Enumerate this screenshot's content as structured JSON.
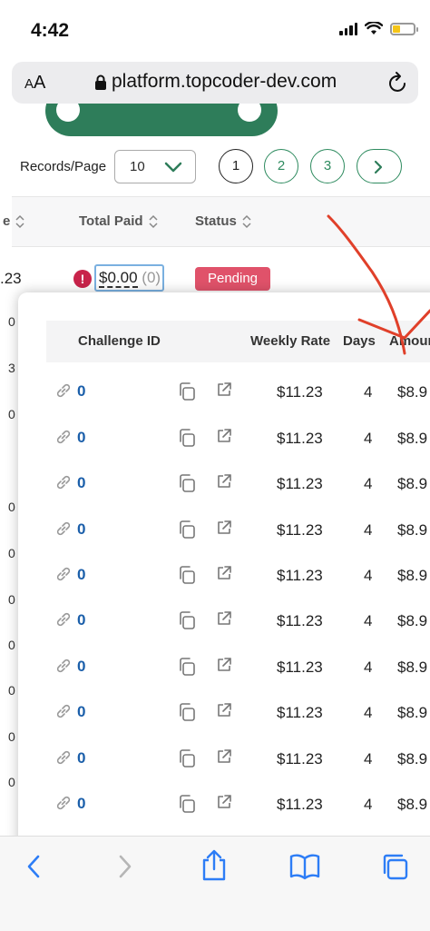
{
  "status_bar": {
    "time": "4:42"
  },
  "browser": {
    "aa_label": "A",
    "aa_label_big": "A",
    "url": "platform.topcoder-dev.com"
  },
  "pagination": {
    "records_label": "Records/Page",
    "records_value": "10",
    "pages": [
      "1",
      "2",
      "3"
    ],
    "active_page": "1"
  },
  "table": {
    "columns": [
      "e",
      "Total Paid",
      "Status"
    ],
    "row": {
      "amount": ".23",
      "paid_value": "$0.00",
      "paid_count": "(0)",
      "status": "Pending"
    }
  },
  "popup": {
    "columns": [
      "Challenge ID",
      "Weekly Rate",
      "Days",
      "Amour"
    ],
    "rows": [
      {
        "challenge_id": "0",
        "weekly_rate": "$11.23",
        "days": "4",
        "amount": "$8.9"
      },
      {
        "challenge_id": "0",
        "weekly_rate": "$11.23",
        "days": "4",
        "amount": "$8.9"
      },
      {
        "challenge_id": "0",
        "weekly_rate": "$11.23",
        "days": "4",
        "amount": "$8.9"
      },
      {
        "challenge_id": "0",
        "weekly_rate": "$11.23",
        "days": "4",
        "amount": "$8.9"
      },
      {
        "challenge_id": "0",
        "weekly_rate": "$11.23",
        "days": "4",
        "amount": "$8.9"
      },
      {
        "challenge_id": "0",
        "weekly_rate": "$11.23",
        "days": "4",
        "amount": "$8.9"
      },
      {
        "challenge_id": "0",
        "weekly_rate": "$11.23",
        "days": "4",
        "amount": "$8.9"
      },
      {
        "challenge_id": "0",
        "weekly_rate": "$11.23",
        "days": "4",
        "amount": "$8.9"
      },
      {
        "challenge_id": "0",
        "weekly_rate": "$11.23",
        "days": "4",
        "amount": "$8.9"
      },
      {
        "challenge_id": "0",
        "weekly_rate": "$11.23",
        "days": "4",
        "amount": "$8.9"
      }
    ]
  },
  "background_side_digits": [
    "0",
    "3",
    "0",
    "0",
    "0",
    "0",
    "0",
    "0",
    "0",
    "0"
  ],
  "colors": {
    "brand_green": "#2e7d5a",
    "pending_red": "#e0526a",
    "link_blue": "#1b5faa",
    "annotation_red": "#e0402a"
  },
  "toolbar": {
    "icons": [
      "back-icon",
      "forward-icon",
      "share-icon",
      "bookmarks-icon",
      "tabs-icon"
    ]
  }
}
